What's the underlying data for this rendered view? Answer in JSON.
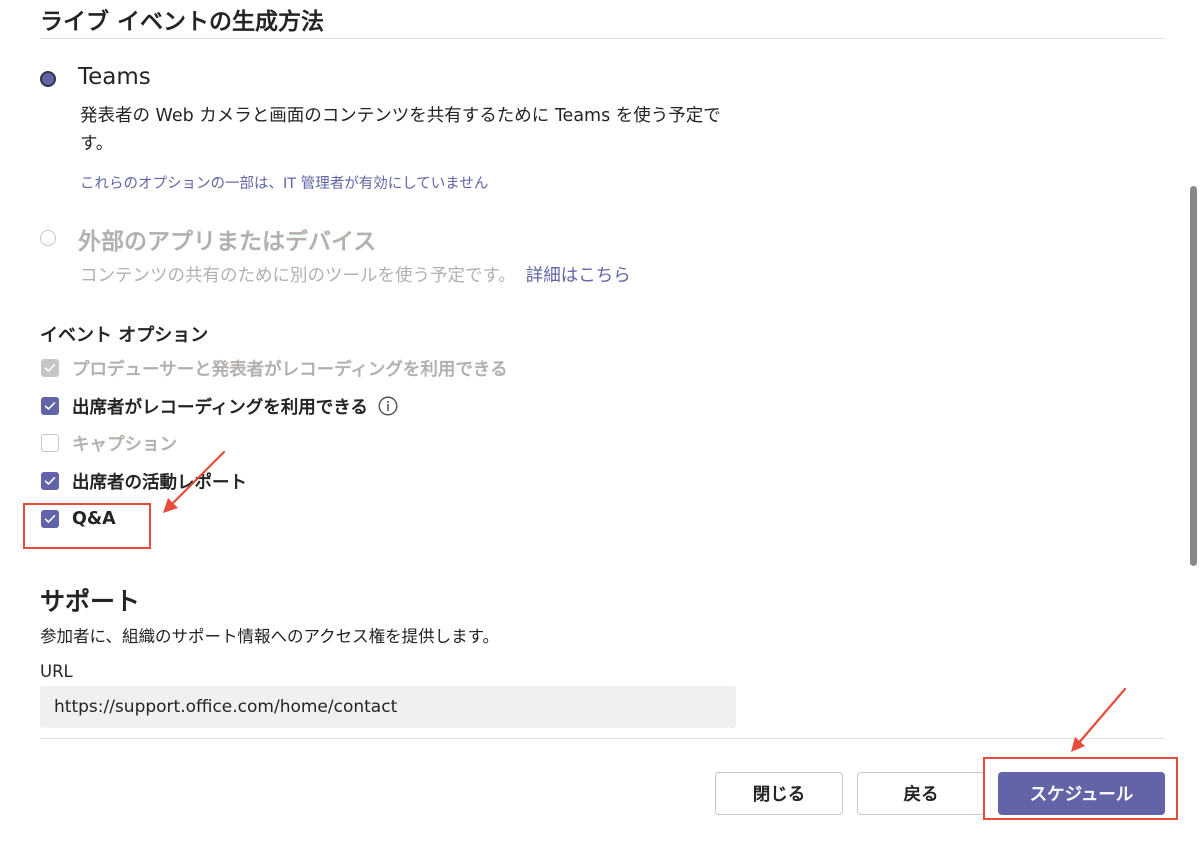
{
  "section": {
    "title": "ライブ イベントの生成方法"
  },
  "methods": [
    {
      "title": "Teams",
      "description": "発表者の Web カメラと画面のコンテンツを共有するために Teams を使う予定です。",
      "note": "これらのオプションの一部は、IT 管理者が有効にしていません",
      "selected": true
    },
    {
      "title": "外部のアプリまたはデバイス",
      "description": "コンテンツの共有のために別のツールを使う予定です。",
      "link": "詳細はこちら",
      "selected": false,
      "disabled": true
    }
  ],
  "event_options": {
    "heading": "イベント オプション",
    "items": [
      {
        "label": "プロデューサーと発表者がレコーディングを利用できる",
        "checked": true,
        "disabled": true
      },
      {
        "label": "出席者がレコーディングを利用できる",
        "checked": true,
        "disabled": false,
        "info_icon": "info-icon"
      },
      {
        "label": "キャプション",
        "checked": false,
        "disabled": true
      },
      {
        "label": "出席者の活動レポート",
        "checked": true,
        "disabled": false
      },
      {
        "label": "Q&A",
        "checked": true,
        "disabled": false
      }
    ]
  },
  "support": {
    "title": "サポート",
    "description": "参加者に、組織のサポート情報へのアクセス権を提供します。",
    "url_label": "URL",
    "url_value": "https://support.office.com/home/contact"
  },
  "footer": {
    "close_label": "閉じる",
    "back_label": "戻る",
    "schedule_label": "スケジュール"
  },
  "colors": {
    "accent": "#6264a7",
    "annotation": "#e84a3c",
    "disabled_text": "#b3b0ad"
  }
}
